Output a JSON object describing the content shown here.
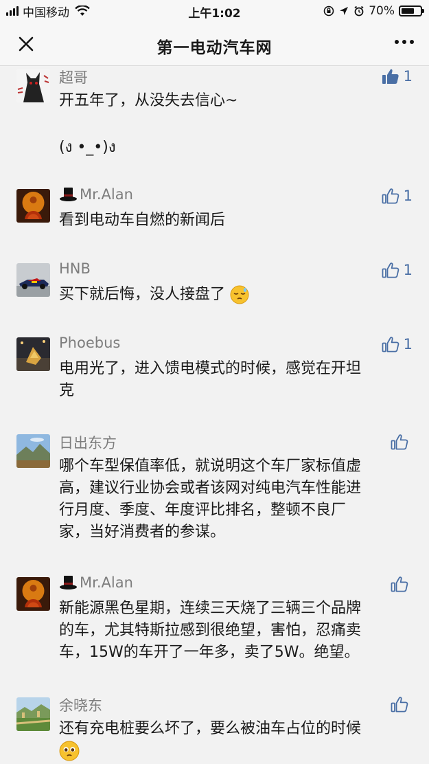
{
  "status_bar": {
    "carrier": "中国移动",
    "time": "上午1:02",
    "battery": "70%"
  },
  "nav": {
    "title": "第一电动汽车网"
  },
  "comments": [
    {
      "user": "超哥",
      "likes": "1",
      "liked": true,
      "lines": [
        "开五年了，从没失去信心~",
        "",
        "(ง •_•)ง"
      ]
    },
    {
      "user": "Mr.Alan",
      "likes": "1",
      "liked": false,
      "lines": [
        "看到电动车自燃的新闻后"
      ]
    },
    {
      "user": "HNB",
      "likes": "1",
      "liked": false,
      "lines": [
        "买下就后悔，没人接盘了"
      ],
      "emoji": "sleepy-face"
    },
    {
      "user": "Phoebus",
      "likes": "1",
      "liked": false,
      "lines": [
        "电用光了，进入馈电模式的时候，感觉在开坦",
        "克"
      ]
    },
    {
      "user": "日出东方",
      "likes": "",
      "liked": false,
      "lines": [
        "哪个车型保值率低，就说明这个车厂家标值虚",
        "高，建议行业协会或者该网对纯电汽车性能进",
        "行月度、季度、年度评比排名，整顿不良厂",
        "家，当好消费者的参谋。"
      ]
    },
    {
      "user": "Mr.Alan",
      "likes": "",
      "liked": false,
      "lines": [
        "新能源黑色星期，连续三天烧了三辆三个品牌",
        "的车，尤其特斯拉感到很绝望，害怕，忍痛卖",
        "车，15W的车开了一年多，卖了5W。绝望。"
      ]
    },
    {
      "user": "余晓东",
      "likes": "",
      "liked": false,
      "lines": [
        "还有充电桩要么坏了，要么被油车占位的时候",
        ""
      ],
      "emoji": "pleading-face"
    }
  ]
}
